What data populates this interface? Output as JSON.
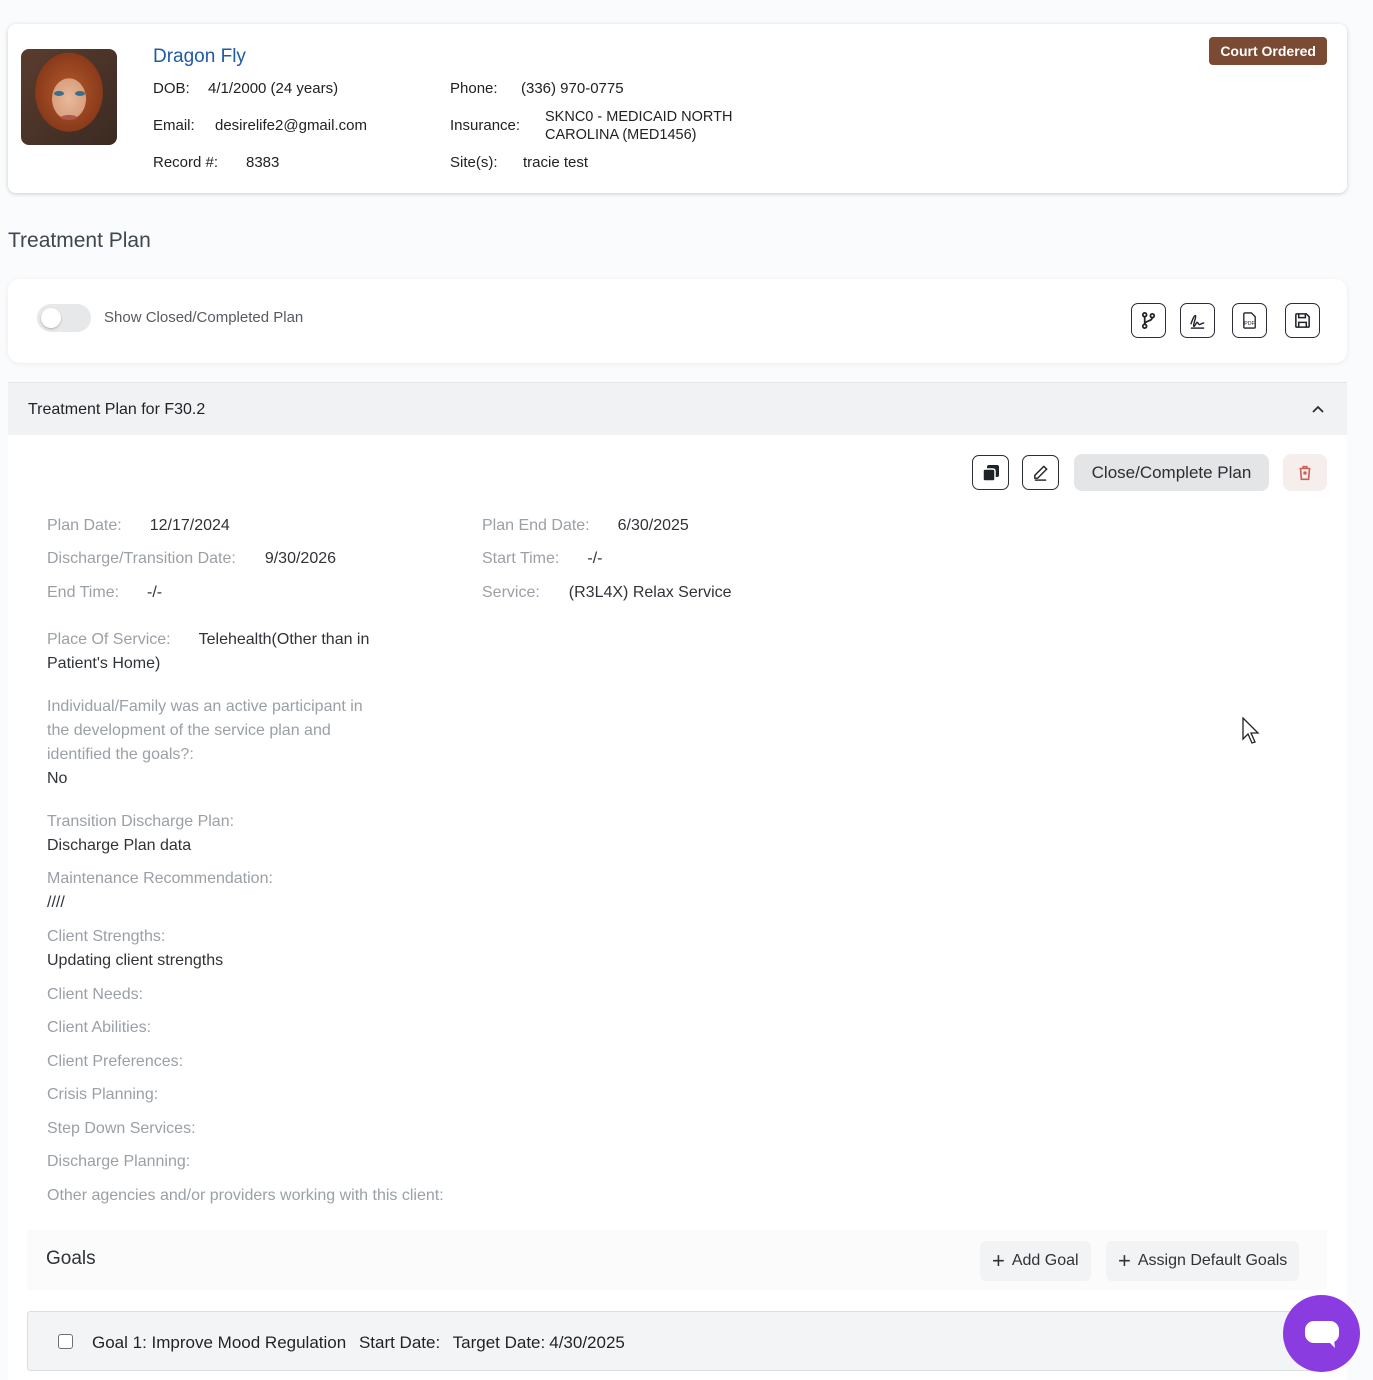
{
  "client": {
    "name": "Dragon Fly",
    "badge": "Court Ordered",
    "dob_label": "DOB:",
    "dob_value": "4/1/2000 (24 years)",
    "email_label": "Email:",
    "email_value": "desirelife2@gmail.com",
    "record_label": "Record #:",
    "record_value": "8383",
    "phone_label": "Phone:",
    "phone_value": "(336) 970-0775",
    "insurance_label": "Insurance:",
    "insurance_line1": "SKNC0 - MEDICAID NORTH",
    "insurance_line2": "CAROLINA (MED1456)",
    "sites_label": "Site(s):",
    "sites_value": "tracie test"
  },
  "page": {
    "section_title": "Treatment Plan",
    "toggle_label": "Show Closed/Completed Plan",
    "toolbar_icons": [
      "branch-icon",
      "signature-icon",
      "pdf-icon",
      "save-icon"
    ]
  },
  "plan": {
    "accordion_title": "Treatment Plan for F30.2",
    "close_label": "Close/Complete Plan",
    "plan_date_label": "Plan Date:",
    "plan_date": "12/17/2024",
    "plan_end_label": "Plan End Date:",
    "plan_end": "6/30/2025",
    "discharge_label": "Discharge/Transition Date:",
    "discharge": "9/30/2026",
    "start_time_label": "Start Time:",
    "start_time": "-/-",
    "end_time_label": "End Time:",
    "end_time": "-/-",
    "service_label": "Service:",
    "service": "(R3L4X) Relax Service",
    "place_label": "Place Of Service:",
    "place_line1": "Telehealth(Other than in",
    "place_line2": "Patient's Home)",
    "participant_q1": "Individual/Family was an active participant in",
    "participant_q2": "the development of the service plan and",
    "participant_q3": "identified the goals?:",
    "participant_a": "No",
    "transition_label": "Transition Discharge Plan:",
    "transition": "Discharge Plan data",
    "maintenance_label": "Maintenance Recommendation:",
    "maintenance": "////",
    "strengths_label": "Client Strengths:",
    "strengths": "Updating client strengths",
    "needs_label": "Client Needs:",
    "abilities_label": "Client Abilities:",
    "preferences_label": "Client Preferences:",
    "crisis_label": "Crisis Planning:",
    "stepdown_label": "Step Down Services:",
    "discharge_planning_label": "Discharge Planning:",
    "agencies_label": "Other agencies and/or providers working with this client:"
  },
  "goals": {
    "title": "Goals",
    "add_label": "Add Goal",
    "assign_label": "Assign Default Goals",
    "items": [
      {
        "name": "Goal 1: Improve Mood Regulation",
        "start_label": "Start Date:",
        "target_label": "Target Date:",
        "target": "4/30/2025"
      }
    ]
  },
  "colors": {
    "accent": "#1f5aa6",
    "badge": "#7a4a33",
    "chat": "#8a3ce0"
  }
}
